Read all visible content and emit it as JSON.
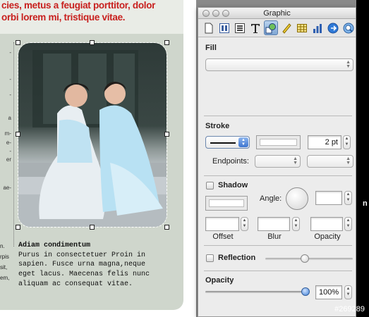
{
  "document": {
    "heading_line1": "cies, metus a feugiat porttitor, dolor",
    "heading_line2": "orbi lorem mi, tristique vitae.",
    "left_column": [
      "n.",
      "rpis",
      "sit,",
      "em,"
    ],
    "edge_chars": [
      "-",
      "-",
      "-",
      "a",
      "m-",
      "e-",
      "-",
      "er",
      "ae-"
    ],
    "caption_title": "Adiam condimentum",
    "caption_lines": [
      "Purus in consectetuer Proin in",
      "sapien. Fusce urna magna,neque",
      "eget lacus. Maecenas felis nunc",
      "aliquam ac consequat vitae."
    ]
  },
  "inspector": {
    "window_title": "Graphic",
    "toolbar": [
      "document-icon",
      "layout-icon",
      "wrap-icon",
      "text-icon",
      "graphic-icon",
      "metrics-icon",
      "table-icon",
      "chart-icon",
      "hyperlink-icon",
      "quicktime-icon"
    ],
    "selected_tool": "graphic-icon",
    "fill": {
      "label": "Fill",
      "value": ""
    },
    "stroke": {
      "label": "Stroke",
      "width": "2 pt",
      "endpoints_label": "Endpoints:"
    },
    "shadow": {
      "label": "Shadow",
      "checked": false,
      "angle_label": "Angle:",
      "angle_value": "",
      "offset_label": "Offset",
      "blur_label": "Blur",
      "opacity_label": "Opacity"
    },
    "reflection": {
      "label": "Reflection",
      "checked": false,
      "level": 0.45
    },
    "opacity": {
      "label": "Opacity",
      "value": "100%",
      "level": 1.0
    }
  },
  "watermark": "#269289",
  "right_char": "n",
  "colors": {
    "heading_red": "#c8201e",
    "page_green": "#cfd6cc",
    "select_blue": "#7fa6d4"
  }
}
